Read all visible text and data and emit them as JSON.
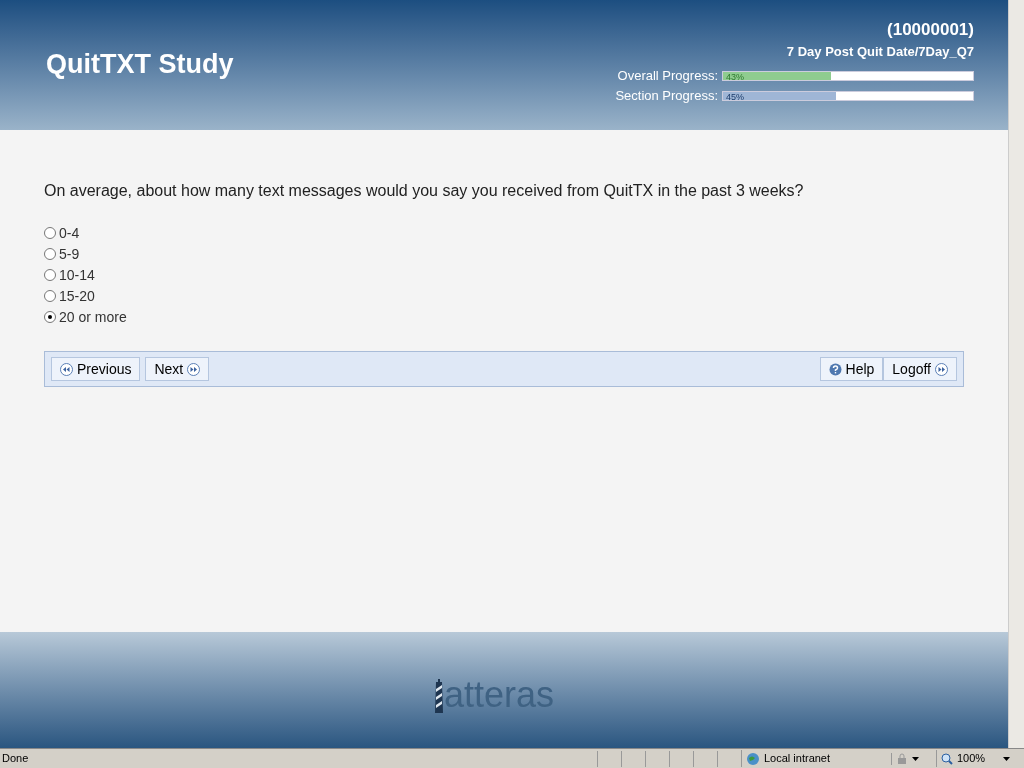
{
  "header": {
    "title": "QuitTXT Study",
    "participant_id": "(10000001)",
    "section": "7 Day Post Quit Date/7Day_Q7",
    "progress": [
      {
        "label": "Overall Progress:",
        "reading": "43%",
        "level": 0.43,
        "kind": "overall"
      },
      {
        "label": "Section Progress:",
        "reading": "45%",
        "level": 0.45,
        "kind": "section"
      }
    ]
  },
  "question": "On average, about how many text messages would you say you received from QuitTX in the past 3 weeks?",
  "options": [
    {
      "label": "0-4",
      "selected": false
    },
    {
      "label": "5-9",
      "selected": false
    },
    {
      "label": "10-14",
      "selected": false
    },
    {
      "label": "15-20",
      "selected": false
    },
    {
      "label": "20 or more",
      "selected": true
    }
  ],
  "nav": {
    "left": [
      {
        "label": "Previous",
        "kind": "back"
      },
      {
        "label": "Next",
        "kind": "forward"
      }
    ],
    "right": [
      {
        "label": "Help",
        "kind": "help"
      },
      {
        "label": "Logoff",
        "kind": "forward"
      }
    ]
  },
  "footer": {
    "logo": "atteras"
  },
  "status_bar": {
    "status": "Done",
    "zone": "Local intranet",
    "zoom": "100%"
  }
}
